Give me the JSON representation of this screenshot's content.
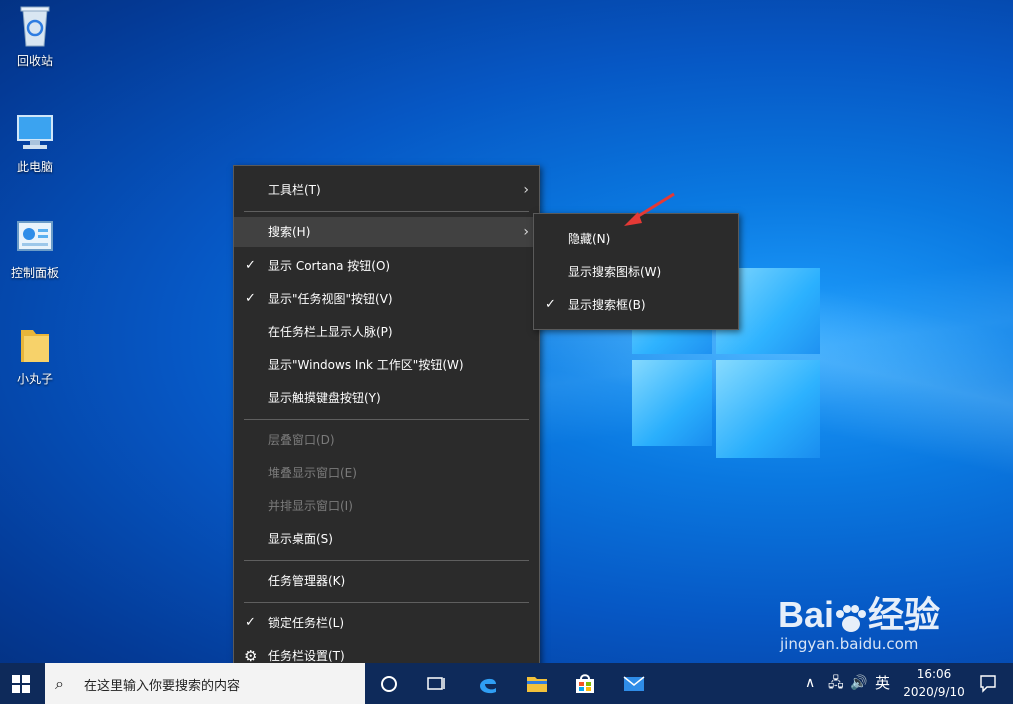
{
  "desktop": {
    "icons": [
      {
        "label": "回收站",
        "icon": "recycle-bin-icon"
      },
      {
        "label": "此电脑",
        "icon": "computer-icon"
      },
      {
        "label": "控制面板",
        "icon": "control-panel-icon"
      },
      {
        "label": "小丸子",
        "icon": "folder-icon"
      }
    ]
  },
  "context_menu": {
    "items": [
      {
        "label": "工具栏(T)",
        "submenu": true
      },
      {
        "label": "搜索(H)",
        "submenu": true,
        "highlighted": true
      },
      {
        "label": "显示 Cortana 按钮(O)",
        "checked": true
      },
      {
        "label": "显示\"任务视图\"按钮(V)",
        "checked": true
      },
      {
        "label": "在任务栏上显示人脉(P)"
      },
      {
        "label": "显示\"Windows Ink 工作区\"按钮(W)"
      },
      {
        "label": "显示触摸键盘按钮(Y)"
      },
      {
        "label": "层叠窗口(D)",
        "disabled": true
      },
      {
        "label": "堆叠显示窗口(E)",
        "disabled": true
      },
      {
        "label": "并排显示窗口(I)",
        "disabled": true
      },
      {
        "label": "显示桌面(S)"
      },
      {
        "label": "任务管理器(K)"
      },
      {
        "label": "锁定任务栏(L)",
        "checked": true
      },
      {
        "label": "任务栏设置(T)",
        "icon": "gear-icon"
      }
    ]
  },
  "search_submenu": {
    "items": [
      {
        "label": "隐藏(N)"
      },
      {
        "label": "显示搜索图标(W)"
      },
      {
        "label": "显示搜索框(B)",
        "checked": true
      }
    ]
  },
  "taskbar": {
    "search_placeholder": "在这里输入你要搜索的内容",
    "apps": [
      "cortana-icon",
      "task-view-icon",
      "edge-icon",
      "file-explorer-icon",
      "store-icon",
      "mail-icon"
    ],
    "tray": {
      "ime": "英"
    },
    "clock": {
      "time": "16:06",
      "date": "2020/9/10"
    }
  },
  "watermark": {
    "text": "Bai",
    "text2": "经验",
    "url": "jingyan.baidu.com"
  },
  "annotation": {
    "arrow_color": "#e53935"
  },
  "colors": {
    "menu_bg": "#2b2b2b",
    "menu_highlight": "#414141",
    "disabled_text": "#7b7b7b"
  }
}
